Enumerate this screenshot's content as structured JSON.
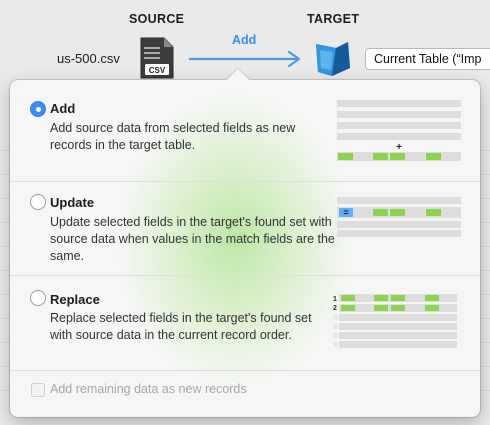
{
  "header": {
    "source_label": "SOURCE",
    "target_label": "TARGET",
    "source_file": "us-500.csv",
    "file_type_badge": "CSV",
    "import_mode": "Add",
    "target_table": "Current Table (“Imp"
  },
  "options": [
    {
      "key": "add",
      "title": "Add",
      "description": "Add source data from selected fields as new records in the target table.",
      "selected": true,
      "diagram_marker": "+"
    },
    {
      "key": "update",
      "title": "Update",
      "description": "Update selected fields in the target's found set with source data when values in the match fields are the same.",
      "selected": false,
      "diagram_marker": "="
    },
    {
      "key": "replace",
      "title": "Replace",
      "description": "Replace selected fields in the target's found set with source data in the current record order.",
      "selected": false,
      "diagram_row_numbers": [
        "1",
        "2"
      ]
    }
  ],
  "checkbox": {
    "label": "Add remaining data as new records",
    "checked": false,
    "enabled": false
  },
  "colors": {
    "accent_blue": "#3b8ef0",
    "arrow_blue": "#4a9bea",
    "green_field": "#8ed34f",
    "match_blue": "#5fb0f0",
    "grid_gray": "#dddddd"
  }
}
